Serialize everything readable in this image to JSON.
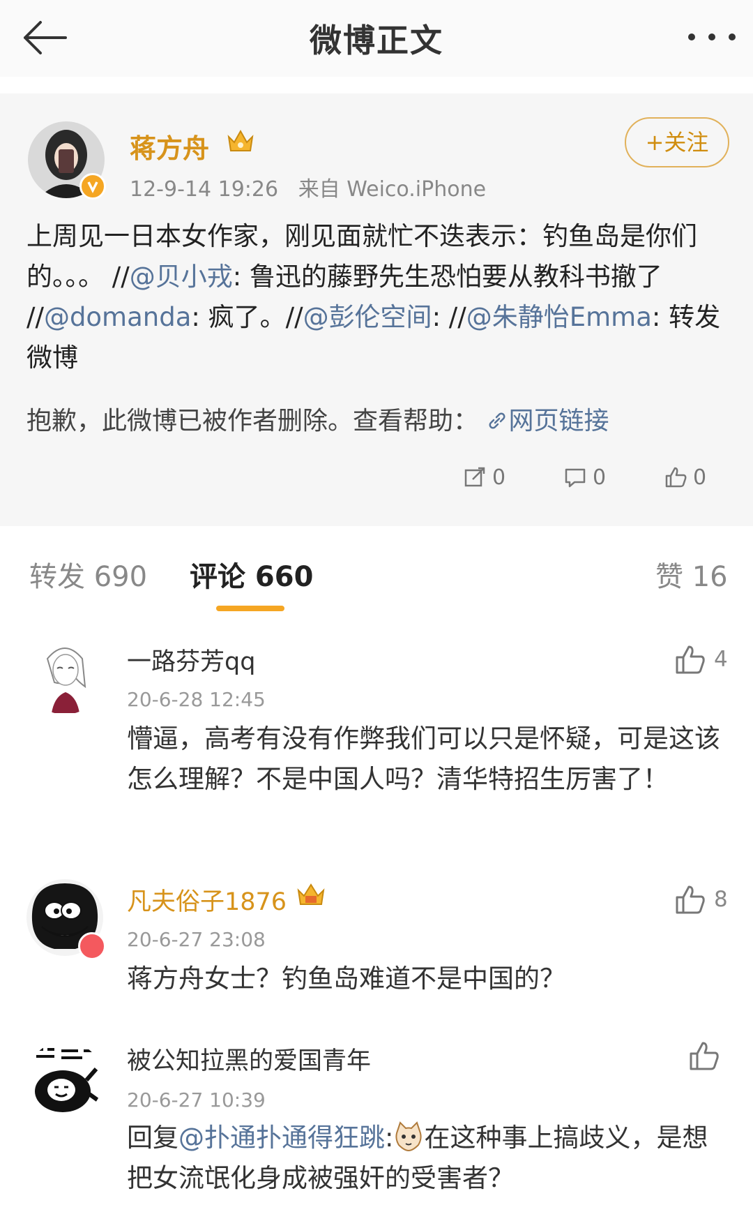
{
  "header": {
    "title": "微博正文"
  },
  "post": {
    "author": "蒋方舟",
    "time": "12-9-14 19:26",
    "source": "来自 Weico.iPhone",
    "follow_label": "+关注",
    "text_parts": {
      "a": "上周见一日本女作家，刚见面就忙不迭表示：钓鱼岛是你们的。。。 //",
      "m1": "@贝小戎",
      "b": ": 鲁迅的藤野先生恐怕要从教科书撤了 //",
      "m2": "@domanda",
      "c": ": 疯了。//",
      "m3": "@彭伦空间",
      "d": ": //",
      "m4": "@朱静怡Emma",
      "e": ": 转发微博"
    },
    "deleted_notice": "抱歉，此微博已被作者删除。查看帮助：",
    "link_label": "网页链接",
    "actions": {
      "repost_count": "0",
      "comment_count": "0",
      "like_count": "0"
    }
  },
  "tabs": [
    {
      "label": "转发 690"
    },
    {
      "label": "评论 660"
    },
    {
      "label": "赞 16"
    }
  ],
  "comments": [
    {
      "name": "一路芬芳qq",
      "time": "20-6-28 12:45",
      "text": "懵逼，高考有没有作弊我们可以只是怀疑，可是这该怎么理解？不是中国人吗？清华特招生厉害了！",
      "likes": "4"
    },
    {
      "name": "凡夫俗子1876",
      "time": "20-6-27 23:08",
      "text": "蒋方舟女士？钓鱼岛难道不是中国的？",
      "likes": "8"
    },
    {
      "name": "被公知拉黑的爱国青年",
      "time": "20-6-27 10:39",
      "reply_prefix": "回复",
      "reply_mention": "@扑通扑通得狂跳",
      "reply_colon": ":",
      "text_after": "在这种事上搞歧义，是想把女流氓化身成被强奸的受害者？",
      "likes": ""
    }
  ],
  "colors": {
    "accent": "#f5a623",
    "link": "#567399",
    "vip_name": "#d7931b"
  }
}
